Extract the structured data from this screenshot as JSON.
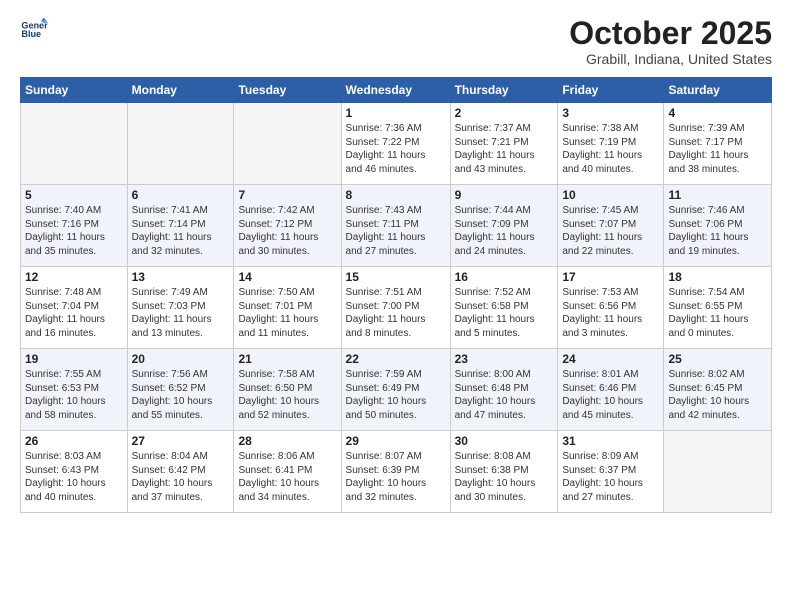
{
  "logo": {
    "line1": "General",
    "line2": "Blue"
  },
  "title": "October 2025",
  "subtitle": "Grabill, Indiana, United States",
  "weekdays": [
    "Sunday",
    "Monday",
    "Tuesday",
    "Wednesday",
    "Thursday",
    "Friday",
    "Saturday"
  ],
  "weeks": [
    [
      {
        "day": "",
        "info": ""
      },
      {
        "day": "",
        "info": ""
      },
      {
        "day": "",
        "info": ""
      },
      {
        "day": "1",
        "info": "Sunrise: 7:36 AM\nSunset: 7:22 PM\nDaylight: 11 hours\nand 46 minutes."
      },
      {
        "day": "2",
        "info": "Sunrise: 7:37 AM\nSunset: 7:21 PM\nDaylight: 11 hours\nand 43 minutes."
      },
      {
        "day": "3",
        "info": "Sunrise: 7:38 AM\nSunset: 7:19 PM\nDaylight: 11 hours\nand 40 minutes."
      },
      {
        "day": "4",
        "info": "Sunrise: 7:39 AM\nSunset: 7:17 PM\nDaylight: 11 hours\nand 38 minutes."
      }
    ],
    [
      {
        "day": "5",
        "info": "Sunrise: 7:40 AM\nSunset: 7:16 PM\nDaylight: 11 hours\nand 35 minutes."
      },
      {
        "day": "6",
        "info": "Sunrise: 7:41 AM\nSunset: 7:14 PM\nDaylight: 11 hours\nand 32 minutes."
      },
      {
        "day": "7",
        "info": "Sunrise: 7:42 AM\nSunset: 7:12 PM\nDaylight: 11 hours\nand 30 minutes."
      },
      {
        "day": "8",
        "info": "Sunrise: 7:43 AM\nSunset: 7:11 PM\nDaylight: 11 hours\nand 27 minutes."
      },
      {
        "day": "9",
        "info": "Sunrise: 7:44 AM\nSunset: 7:09 PM\nDaylight: 11 hours\nand 24 minutes."
      },
      {
        "day": "10",
        "info": "Sunrise: 7:45 AM\nSunset: 7:07 PM\nDaylight: 11 hours\nand 22 minutes."
      },
      {
        "day": "11",
        "info": "Sunrise: 7:46 AM\nSunset: 7:06 PM\nDaylight: 11 hours\nand 19 minutes."
      }
    ],
    [
      {
        "day": "12",
        "info": "Sunrise: 7:48 AM\nSunset: 7:04 PM\nDaylight: 11 hours\nand 16 minutes."
      },
      {
        "day": "13",
        "info": "Sunrise: 7:49 AM\nSunset: 7:03 PM\nDaylight: 11 hours\nand 13 minutes."
      },
      {
        "day": "14",
        "info": "Sunrise: 7:50 AM\nSunset: 7:01 PM\nDaylight: 11 hours\nand 11 minutes."
      },
      {
        "day": "15",
        "info": "Sunrise: 7:51 AM\nSunset: 7:00 PM\nDaylight: 11 hours\nand 8 minutes."
      },
      {
        "day": "16",
        "info": "Sunrise: 7:52 AM\nSunset: 6:58 PM\nDaylight: 11 hours\nand 5 minutes."
      },
      {
        "day": "17",
        "info": "Sunrise: 7:53 AM\nSunset: 6:56 PM\nDaylight: 11 hours\nand 3 minutes."
      },
      {
        "day": "18",
        "info": "Sunrise: 7:54 AM\nSunset: 6:55 PM\nDaylight: 11 hours\nand 0 minutes."
      }
    ],
    [
      {
        "day": "19",
        "info": "Sunrise: 7:55 AM\nSunset: 6:53 PM\nDaylight: 10 hours\nand 58 minutes."
      },
      {
        "day": "20",
        "info": "Sunrise: 7:56 AM\nSunset: 6:52 PM\nDaylight: 10 hours\nand 55 minutes."
      },
      {
        "day": "21",
        "info": "Sunrise: 7:58 AM\nSunset: 6:50 PM\nDaylight: 10 hours\nand 52 minutes."
      },
      {
        "day": "22",
        "info": "Sunrise: 7:59 AM\nSunset: 6:49 PM\nDaylight: 10 hours\nand 50 minutes."
      },
      {
        "day": "23",
        "info": "Sunrise: 8:00 AM\nSunset: 6:48 PM\nDaylight: 10 hours\nand 47 minutes."
      },
      {
        "day": "24",
        "info": "Sunrise: 8:01 AM\nSunset: 6:46 PM\nDaylight: 10 hours\nand 45 minutes."
      },
      {
        "day": "25",
        "info": "Sunrise: 8:02 AM\nSunset: 6:45 PM\nDaylight: 10 hours\nand 42 minutes."
      }
    ],
    [
      {
        "day": "26",
        "info": "Sunrise: 8:03 AM\nSunset: 6:43 PM\nDaylight: 10 hours\nand 40 minutes."
      },
      {
        "day": "27",
        "info": "Sunrise: 8:04 AM\nSunset: 6:42 PM\nDaylight: 10 hours\nand 37 minutes."
      },
      {
        "day": "28",
        "info": "Sunrise: 8:06 AM\nSunset: 6:41 PM\nDaylight: 10 hours\nand 34 minutes."
      },
      {
        "day": "29",
        "info": "Sunrise: 8:07 AM\nSunset: 6:39 PM\nDaylight: 10 hours\nand 32 minutes."
      },
      {
        "day": "30",
        "info": "Sunrise: 8:08 AM\nSunset: 6:38 PM\nDaylight: 10 hours\nand 30 minutes."
      },
      {
        "day": "31",
        "info": "Sunrise: 8:09 AM\nSunset: 6:37 PM\nDaylight: 10 hours\nand 27 minutes."
      },
      {
        "day": "",
        "info": ""
      }
    ]
  ]
}
